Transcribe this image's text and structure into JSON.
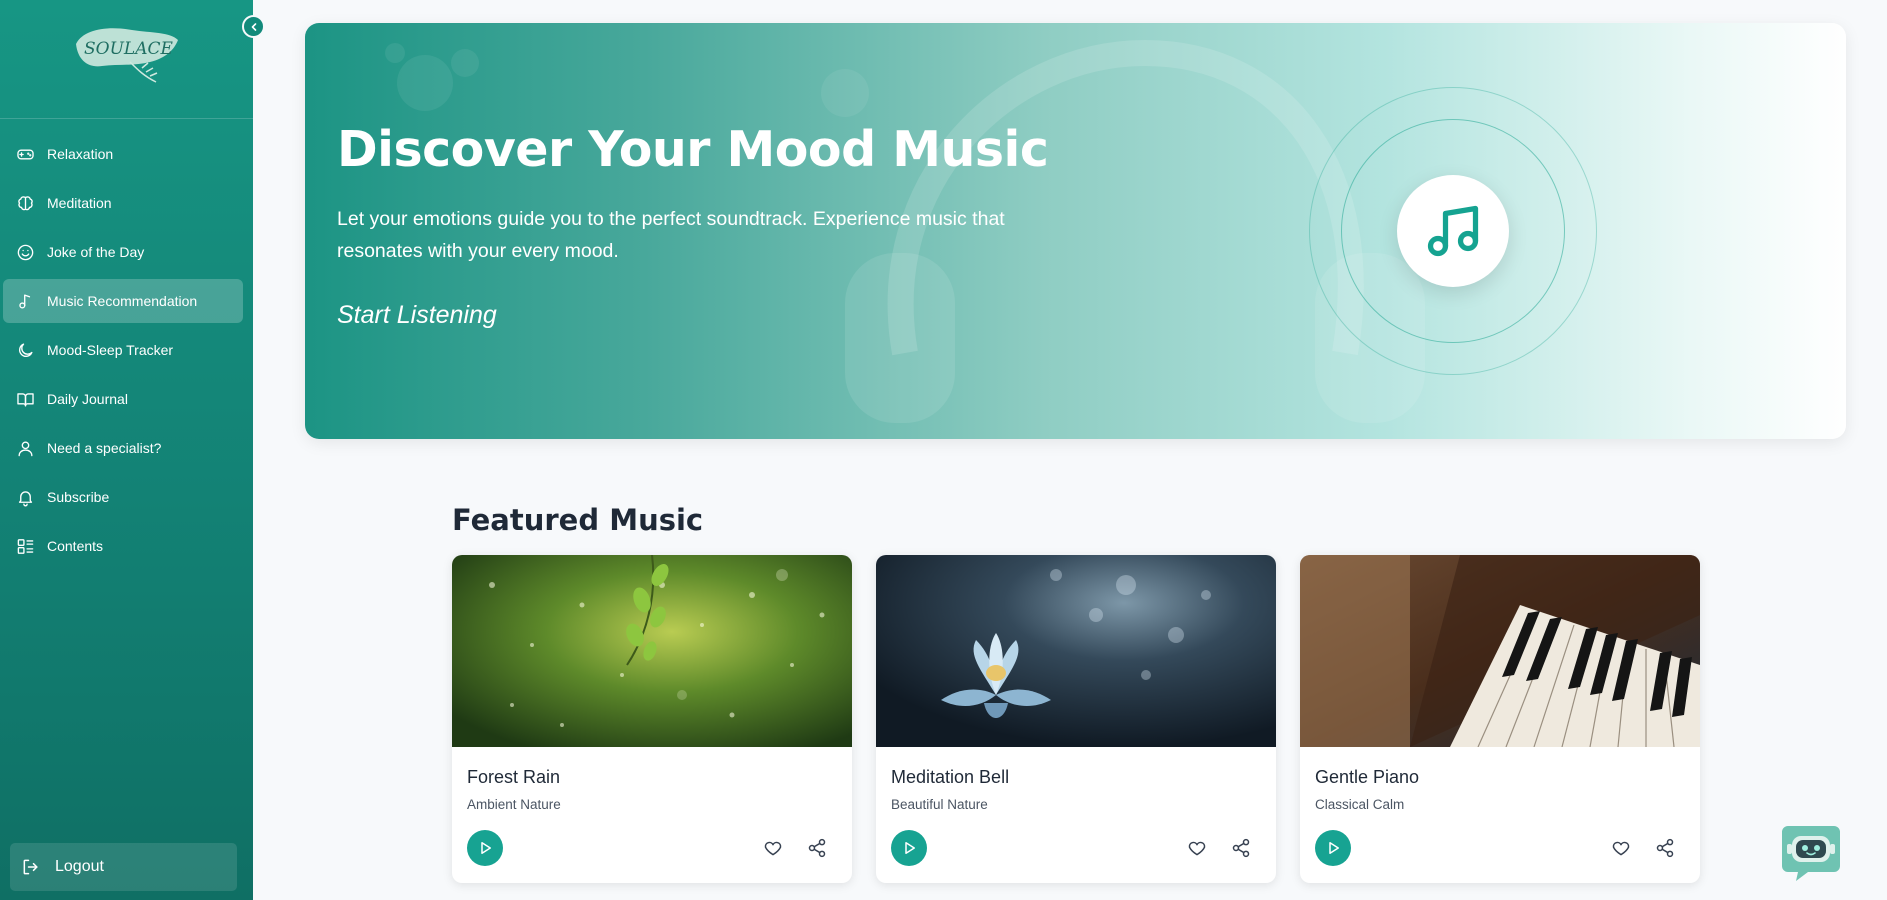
{
  "app": {
    "logo_text": "SOULACE"
  },
  "sidebar": {
    "items": [
      {
        "label": "Relaxation",
        "icon": "gamepad-icon",
        "active": false
      },
      {
        "label": "Meditation",
        "icon": "brain-icon",
        "active": false
      },
      {
        "label": "Joke of the Day",
        "icon": "smile-icon",
        "active": false
      },
      {
        "label": "Music Recommendation",
        "icon": "music-note-icon",
        "active": true
      },
      {
        "label": "Mood-Sleep Tracker",
        "icon": "moon-icon",
        "active": false
      },
      {
        "label": "Daily Journal",
        "icon": "book-open-icon",
        "active": false
      },
      {
        "label": "Need a specialist?",
        "icon": "user-icon",
        "active": false
      },
      {
        "label": "Subscribe",
        "icon": "bell-icon",
        "active": false
      },
      {
        "label": "Contents",
        "icon": "list-grid-icon",
        "active": false
      }
    ],
    "logout_label": "Logout"
  },
  "hero": {
    "title": "Discover Your Mood Music",
    "subtitle": "Let your emotions guide you to the perfect soundtrack. Experience music that resonates with your every mood.",
    "cta": "Start Listening"
  },
  "featured": {
    "title": "Featured Music",
    "cards": [
      {
        "title": "Forest Rain",
        "subtitle": "Ambient Nature"
      },
      {
        "title": "Meditation Bell",
        "subtitle": "Beautiful Nature"
      },
      {
        "title": "Gentle Piano",
        "subtitle": "Classical Calm"
      }
    ]
  },
  "colors": {
    "brand_teal": "#179684",
    "accent": "#17a392",
    "page_bg": "#f7f9fb"
  }
}
